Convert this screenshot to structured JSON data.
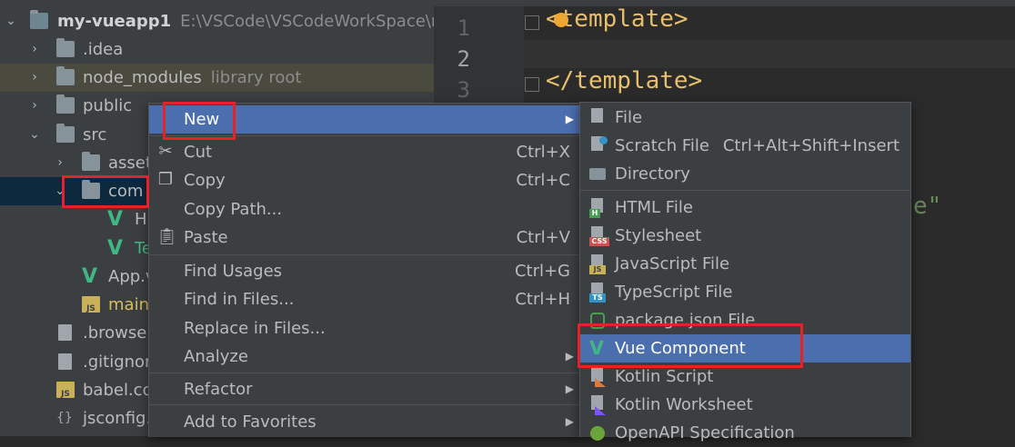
{
  "tree": {
    "rows": [
      {
        "label": "my-vueapp1",
        "sub": "E:\\VSCode\\VSCodeWorkSpace\\my"
      },
      {
        "label": ".idea"
      },
      {
        "label": "node_modules",
        "sub": "library root"
      },
      {
        "label": "public"
      },
      {
        "label": "src"
      },
      {
        "label": "asset"
      },
      {
        "label": "com"
      },
      {
        "label": "H"
      },
      {
        "label": "Te"
      },
      {
        "label": "App.v"
      },
      {
        "label": "main"
      },
      {
        "label": ".browser"
      },
      {
        "label": ".gitignor"
      },
      {
        "label": "babel.co"
      },
      {
        "label": "jsconfig."
      }
    ]
  },
  "editor": {
    "lines": [
      "1",
      "2",
      "3"
    ],
    "code1": "<template>",
    "code3": "</template>",
    "str_tail": "e\""
  },
  "context_menu": {
    "new": "New",
    "cut": "Cut",
    "cut_sc": "Ctrl+X",
    "copy": "Copy",
    "copy_sc": "Ctrl+C",
    "copy_path": "Copy Path...",
    "paste": "Paste",
    "paste_sc": "Ctrl+V",
    "find_usages": "Find Usages",
    "find_usages_sc": "Ctrl+G",
    "find_in_files": "Find in Files...",
    "find_in_files_sc": "Ctrl+H",
    "replace_in_files": "Replace in Files...",
    "analyze": "Analyze",
    "refactor": "Refactor",
    "add_to_favorites": "Add to Favorites"
  },
  "submenu": {
    "file": "File",
    "scratch_file": "Scratch File",
    "scratch_sc": "Ctrl+Alt+Shift+Insert",
    "directory": "Directory",
    "html_file": "HTML File",
    "stylesheet": "Stylesheet",
    "js_file": "JavaScript File",
    "ts_file": "TypeScript File",
    "package_json": "package.json File",
    "vue_component": "Vue Component",
    "kotlin_script": "Kotlin Script",
    "kotlin_worksheet": "Kotlin Worksheet",
    "openapi": "OpenAPI Specification"
  },
  "colors": {
    "accent": "#4b6eaf",
    "highlight_box": "#e8202a",
    "vue_green": "#41b883"
  }
}
